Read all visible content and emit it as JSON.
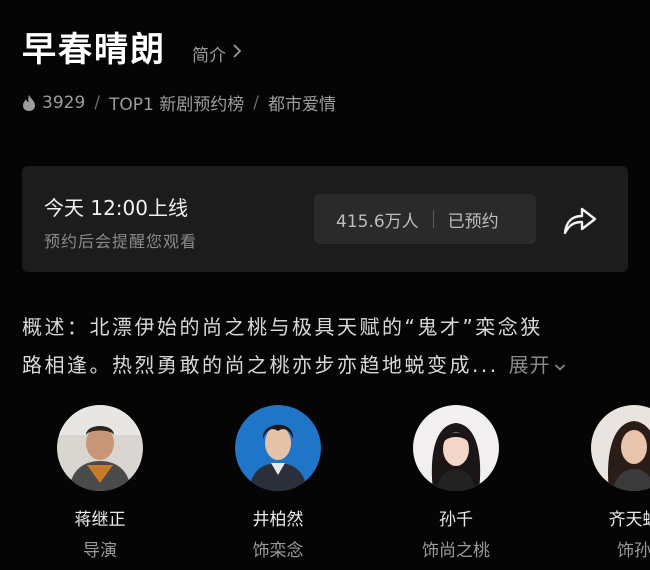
{
  "show": {
    "title": "早春晴朗",
    "intro_link": "简介"
  },
  "meta": {
    "heat": "3929",
    "rank": "TOP1 新剧预约榜",
    "genre": "都市爱情"
  },
  "reservation": {
    "launch_text": "今天 12:00上线",
    "hint": "预约后会提醒您观看",
    "count": "415.6万人",
    "status": "已预约"
  },
  "synopsis": {
    "line1": "概述：北漂伊始的尚之桃与极具天赋的“鬼才”栾念狭",
    "line2": "路相逢。热烈勇敢的尚之桃亦步亦趋地蜕变成...",
    "expand_label": "展开"
  },
  "cast": [
    {
      "name": "蒋继正",
      "role": "导演"
    },
    {
      "name": "井柏然",
      "role": "饰栾念"
    },
    {
      "name": "孙千",
      "role": "饰尚之桃"
    },
    {
      "name": "齐天蚂",
      "role": "饰孙"
    }
  ],
  "colors": {
    "background": "#050505",
    "card": "#1c1c1c",
    "pill": "#2a2a2a"
  }
}
